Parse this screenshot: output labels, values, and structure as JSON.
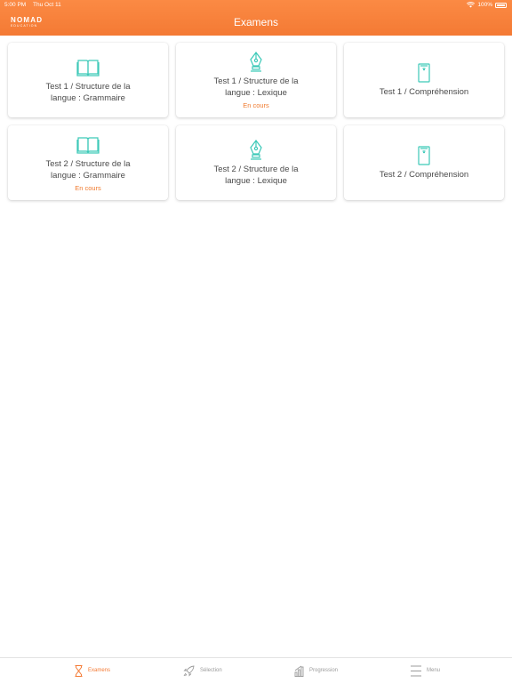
{
  "status_bar": {
    "time": "5:00 PM",
    "date": "Thu Oct 11",
    "battery": "100%"
  },
  "header": {
    "logo_main": "NOMAD",
    "logo_sub": "EDUCATION",
    "title": "Examens"
  },
  "colors": {
    "accent": "#f47a34",
    "icon_teal": "#3cc9b8",
    "status_orange": "#f07a2e"
  },
  "cards": [
    {
      "title": "Test 1 / Structure de la langue : Grammaire",
      "icon": "book-icon",
      "status": ""
    },
    {
      "title": "Test 1 / Structure de la langue : Lexique",
      "icon": "pen-nib-icon",
      "status": "En cours"
    },
    {
      "title": "Test 1 / Compréhension",
      "icon": "document-icon",
      "status": ""
    },
    {
      "title": "Test 2 / Structure de la langue : Grammaire",
      "icon": "book-icon",
      "status": "En cours"
    },
    {
      "title": "Test 2 / Structure de la langue : Lexique",
      "icon": "pen-nib-icon",
      "status": ""
    },
    {
      "title": "Test 2 / Compréhension",
      "icon": "document-icon",
      "status": ""
    }
  ],
  "tabbar": {
    "items": [
      {
        "label": "Examens",
        "icon": "hourglass-icon",
        "active": true
      },
      {
        "label": "Sélection",
        "icon": "rocket-icon",
        "active": false
      },
      {
        "label": "Progression",
        "icon": "chart-icon",
        "active": false
      },
      {
        "label": "Menu",
        "icon": "menu-icon",
        "active": false
      }
    ]
  }
}
